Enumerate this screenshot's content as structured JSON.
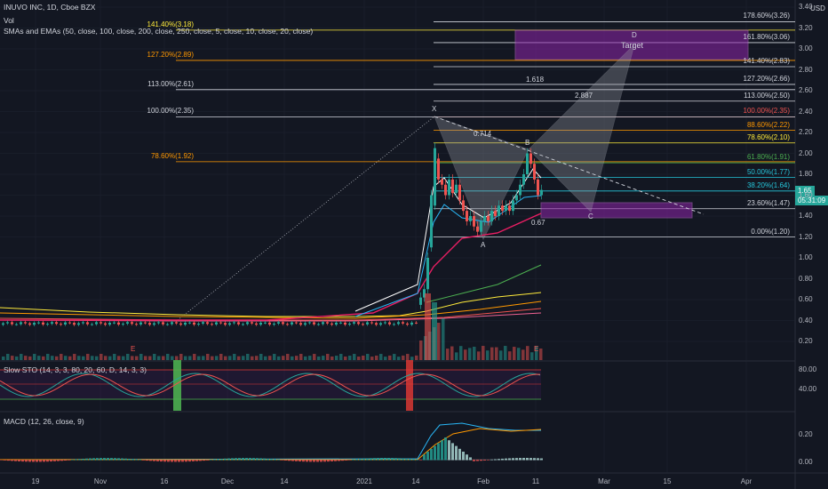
{
  "header": {
    "symbol_line": "INUVO INC, 1D, Cboe BZX",
    "vol_label": "Vol",
    "ma_label": "SMAs and EMAs (50, close, 100, close, 200, close, 250, close, 5, close, 10, close, 20, close)",
    "currency": "USD"
  },
  "price_badge": {
    "value": "1.65",
    "countdown": "05:31:09"
  },
  "indicators": {
    "sto_label": "Slow STO (14, 3, 3, 80, 20, 60, D, 14, 3, 3)",
    "macd_label": "MACD (12, 26, close, 9)"
  },
  "colors": {
    "background": "#131722",
    "grid": "#1f2430",
    "up": "#26a69a",
    "down": "#ef5350",
    "purple_zone": "#8e24aa",
    "sto_green": "#4caf50",
    "sto_red": "#e53935"
  },
  "fib_right": [
    {
      "label": "178.60%(3.26)",
      "color": "#d1d4dc"
    },
    {
      "label": "161.80%(3.06)",
      "color": "#d1d4dc"
    },
    {
      "label": "141.40%(2.83)",
      "color": "#d1d4dc"
    },
    {
      "label": "127.20%(2.66)",
      "color": "#d1d4dc"
    },
    {
      "label": "113.00%(2.50)",
      "color": "#d1d4dc"
    },
    {
      "label": "100.00%(2.35)",
      "color": "#ef5350"
    },
    {
      "label": "88.60%(2.22)",
      "color": "#ff9800"
    },
    {
      "label": "78.60%(2.10)",
      "color": "#ffeb3b"
    },
    {
      "label": "61.80%(1.91)",
      "color": "#4caf50"
    },
    {
      "label": "50.00%(1.77)",
      "color": "#26c6da"
    },
    {
      "label": "38.20%(1.64)",
      "color": "#26c6da"
    },
    {
      "label": "23.60%(1.47)",
      "color": "#d1d4dc"
    },
    {
      "label": "0.00%(1.20)",
      "color": "#d1d4dc"
    }
  ],
  "fib_left": [
    {
      "label": "141.40%(3.18)",
      "color": "#ffeb3b"
    },
    {
      "label": "127.20%(2.89)",
      "color": "#ff9800"
    },
    {
      "label": "113.00%(2.61)",
      "color": "#d1d4dc"
    },
    {
      "label": "100.00%(2.35)",
      "color": "#d1d4dc"
    },
    {
      "label": "78.60%(1.92)",
      "color": "#ff9800"
    }
  ],
  "pattern_labels": {
    "x": "X",
    "a": "A",
    "b": "B",
    "c": "C",
    "d": "D",
    "target": "Target",
    "r1": "0.714",
    "r2": "0.67",
    "r3": "1.618",
    "r4": "2.887",
    "earnings1": "E",
    "earnings2": "E"
  },
  "price_axis": [
    "3.40",
    "3.20",
    "3.00",
    "2.80",
    "2.60",
    "2.40",
    "2.20",
    "2.00",
    "1.80",
    "1.60",
    "1.40",
    "1.20",
    "1.00",
    "0.80",
    "0.60",
    "0.40",
    "0.20"
  ],
  "sto_axis": [
    "80.00",
    "40.00"
  ],
  "macd_axis": [
    "0.20",
    "0.00"
  ],
  "time_axis": [
    "19",
    "Nov",
    "16",
    "Dec",
    "14",
    "2021",
    "14",
    "Feb",
    "11",
    "Mar",
    "15",
    "Apr"
  ],
  "chart_data": {
    "type": "candlestick",
    "symbol": "INUVO INC",
    "interval": "1D",
    "y_range": [
      0.1,
      3.45
    ],
    "fib_levels": [
      3.26,
      3.06,
      2.83,
      2.66,
      2.5,
      2.35,
      2.22,
      2.1,
      1.91,
      1.77,
      1.64,
      1.47,
      1.2
    ],
    "left_fib_levels": [
      3.18,
      2.89,
      2.61,
      2.35,
      1.92
    ],
    "last_price": 1.65,
    "harmonic_points": {
      "X": 2.35,
      "A": 1.22,
      "B": 2.03,
      "C": 1.42,
      "D": 3.05
    }
  }
}
